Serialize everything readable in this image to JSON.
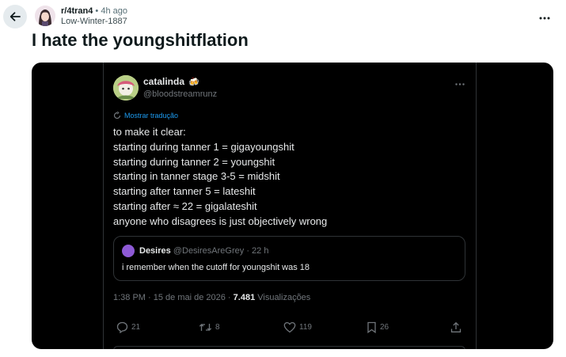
{
  "header": {
    "subreddit": "r/4tran4",
    "separator": "•",
    "age": "4h ago",
    "author": "Low-Winter-1887",
    "more_icon": "ellipsis-icon"
  },
  "post": {
    "title": "I hate the youngshitflation"
  },
  "tweet": {
    "display_name": "catalinda",
    "name_emoji": "🍻",
    "handle": "@bloodstreamrunz",
    "translate_label": "Mostrar tradução",
    "body_lines": [
      "to make it clear:",
      "starting during tanner 1 = gigayoungshit",
      "starting during tanner 2 = youngshit",
      "starting in tanner stage 3-5 = midshit",
      "starting after tanner 5 = lateshit",
      "starting after ≈ 22 = gigalateshit",
      "anyone who disagrees is just objectively wrong"
    ],
    "quote": {
      "name": "Desires",
      "handle": "@DesiresAreGrey",
      "separator": "·",
      "time": "22 h",
      "text": "i remember when the cutoff for youngshit was 18"
    },
    "meta": {
      "time_date": "1:38 PM · 15 de mai de 2026 · ",
      "views_count": "7.481",
      "views_label": " Visualizações"
    },
    "actions": {
      "replies": "21",
      "retweets": "8",
      "likes": "119",
      "bookmarks": "26"
    }
  },
  "colors": {
    "tweet_bg": "#000000",
    "link_blue": "#1d9bf0",
    "muted": "#71767b"
  }
}
